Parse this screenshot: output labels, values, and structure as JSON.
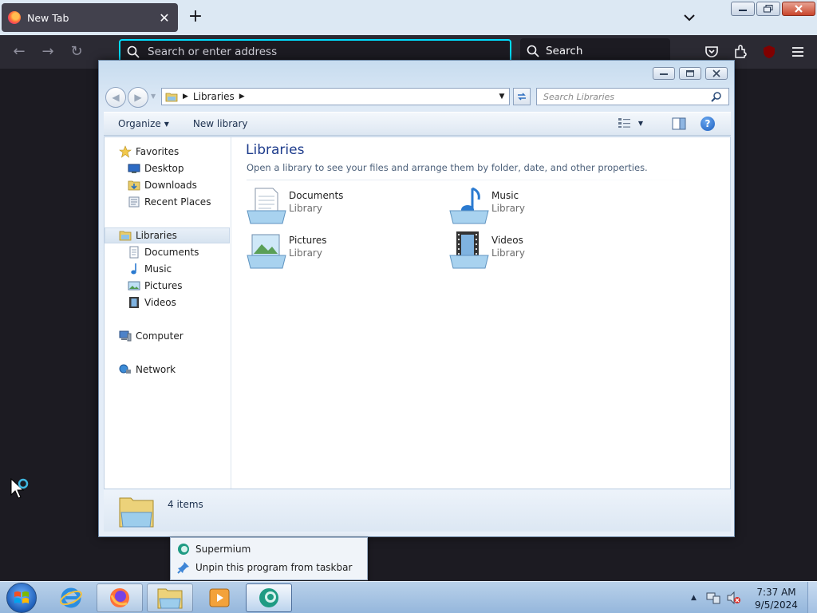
{
  "browser": {
    "tab_title": "New Tab",
    "url_placeholder": "Search or enter address",
    "search_label": "Search",
    "extension_badge": "uo"
  },
  "explorer": {
    "breadcrumb": "Libraries",
    "search_placeholder": "Search Libraries",
    "toolbar": {
      "organize": "Organize",
      "new_library": "New library"
    },
    "nav": {
      "favorites": "Favorites",
      "favorites_items": [
        "Desktop",
        "Downloads",
        "Recent Places"
      ],
      "libraries": "Libraries",
      "libraries_items": [
        "Documents",
        "Music",
        "Pictures",
        "Videos"
      ],
      "computer": "Computer",
      "network": "Network"
    },
    "content": {
      "title": "Libraries",
      "description": "Open a library to see your files and arrange them by folder, date, and other properties.",
      "libraries": [
        {
          "name": "Documents",
          "kind": "Library"
        },
        {
          "name": "Music",
          "kind": "Library"
        },
        {
          "name": "Pictures",
          "kind": "Library"
        },
        {
          "name": "Videos",
          "kind": "Library"
        }
      ]
    },
    "status": {
      "count": "4 items"
    }
  },
  "jumplist": {
    "items": [
      "Supermium",
      "Unpin this program from taskbar"
    ]
  },
  "taskbar": {
    "time": "7:37 AM",
    "date": "9/5/2024"
  },
  "colors": {
    "accent_focus": "#00ddff",
    "browser_dark": "#2b2a33",
    "title_blue": "#1e3c8c"
  }
}
